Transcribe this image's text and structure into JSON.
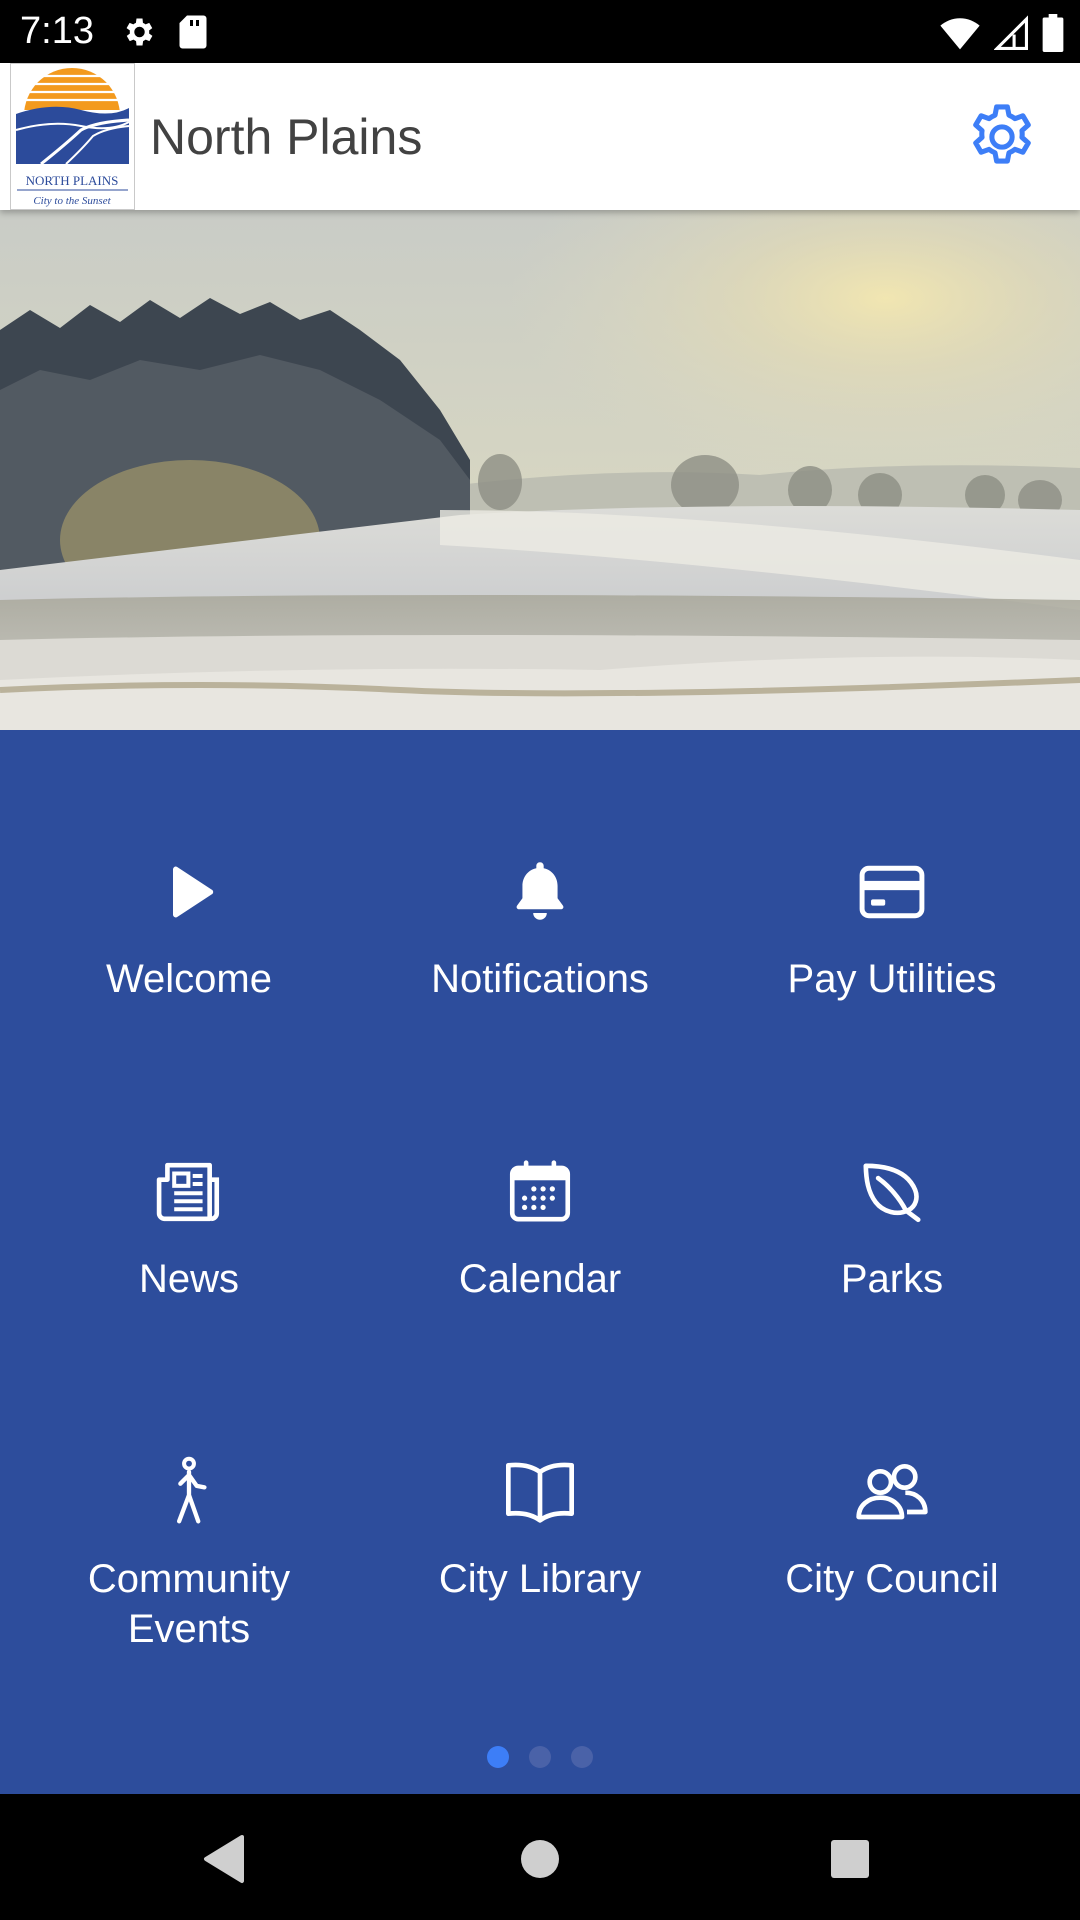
{
  "status_bar": {
    "time": "7:13",
    "icons": [
      "settings-icon",
      "sd-card-icon",
      "wifi-icon",
      "signal-icon",
      "battery-icon"
    ]
  },
  "app_bar": {
    "title": "North Plains",
    "logo": {
      "line1": "NORTH PLAINS",
      "line2": "City to the Sunset"
    },
    "settings_icon": "gear-icon"
  },
  "hero": {
    "description": "hero-image"
  },
  "grid": {
    "tiles": [
      {
        "label": "Welcome",
        "icon": "play-icon"
      },
      {
        "label": "Notifications",
        "icon": "bell-icon"
      },
      {
        "label": "Pay Utilities",
        "icon": "credit-card-icon"
      },
      {
        "label": "News",
        "icon": "newspaper-icon"
      },
      {
        "label": "Calendar",
        "icon": "calendar-icon"
      },
      {
        "label": "Parks",
        "icon": "leaf-icon"
      },
      {
        "label": "Community Events",
        "icon": "walking-person-icon"
      },
      {
        "label": "City Library",
        "icon": "open-book-icon"
      },
      {
        "label": "City Council",
        "icon": "people-icon"
      }
    ],
    "page_count": 3,
    "active_page": 1
  },
  "colors": {
    "panel_bg": "#2d4d9c",
    "accent": "#3d7ef7",
    "title_text": "#424242"
  },
  "nav_bar": {
    "buttons": [
      "back-icon",
      "home-icon",
      "recents-icon"
    ]
  }
}
